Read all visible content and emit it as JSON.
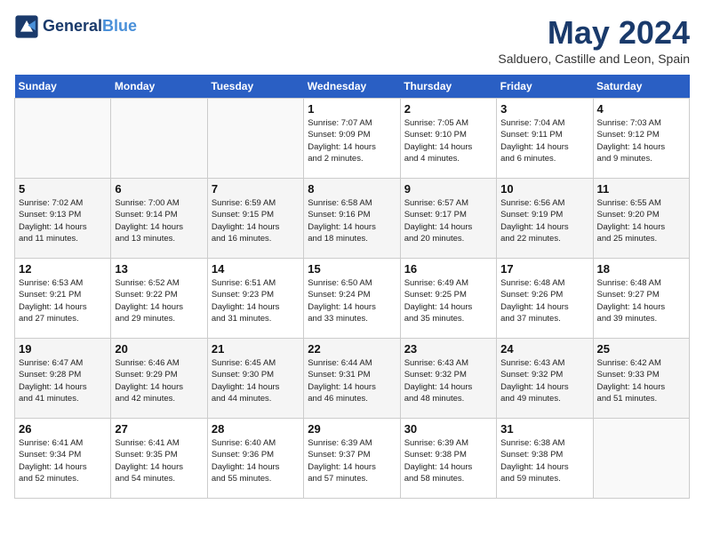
{
  "header": {
    "logo_line1": "General",
    "logo_line2": "Blue",
    "month_title": "May 2024",
    "location": "Salduero, Castille and Leon, Spain"
  },
  "days_of_week": [
    "Sunday",
    "Monday",
    "Tuesday",
    "Wednesday",
    "Thursday",
    "Friday",
    "Saturday"
  ],
  "weeks": [
    [
      {
        "day": "",
        "info": ""
      },
      {
        "day": "",
        "info": ""
      },
      {
        "day": "",
        "info": ""
      },
      {
        "day": "1",
        "info": "Sunrise: 7:07 AM\nSunset: 9:09 PM\nDaylight: 14 hours\nand 2 minutes."
      },
      {
        "day": "2",
        "info": "Sunrise: 7:05 AM\nSunset: 9:10 PM\nDaylight: 14 hours\nand 4 minutes."
      },
      {
        "day": "3",
        "info": "Sunrise: 7:04 AM\nSunset: 9:11 PM\nDaylight: 14 hours\nand 6 minutes."
      },
      {
        "day": "4",
        "info": "Sunrise: 7:03 AM\nSunset: 9:12 PM\nDaylight: 14 hours\nand 9 minutes."
      }
    ],
    [
      {
        "day": "5",
        "info": "Sunrise: 7:02 AM\nSunset: 9:13 PM\nDaylight: 14 hours\nand 11 minutes."
      },
      {
        "day": "6",
        "info": "Sunrise: 7:00 AM\nSunset: 9:14 PM\nDaylight: 14 hours\nand 13 minutes."
      },
      {
        "day": "7",
        "info": "Sunrise: 6:59 AM\nSunset: 9:15 PM\nDaylight: 14 hours\nand 16 minutes."
      },
      {
        "day": "8",
        "info": "Sunrise: 6:58 AM\nSunset: 9:16 PM\nDaylight: 14 hours\nand 18 minutes."
      },
      {
        "day": "9",
        "info": "Sunrise: 6:57 AM\nSunset: 9:17 PM\nDaylight: 14 hours\nand 20 minutes."
      },
      {
        "day": "10",
        "info": "Sunrise: 6:56 AM\nSunset: 9:19 PM\nDaylight: 14 hours\nand 22 minutes."
      },
      {
        "day": "11",
        "info": "Sunrise: 6:55 AM\nSunset: 9:20 PM\nDaylight: 14 hours\nand 25 minutes."
      }
    ],
    [
      {
        "day": "12",
        "info": "Sunrise: 6:53 AM\nSunset: 9:21 PM\nDaylight: 14 hours\nand 27 minutes."
      },
      {
        "day": "13",
        "info": "Sunrise: 6:52 AM\nSunset: 9:22 PM\nDaylight: 14 hours\nand 29 minutes."
      },
      {
        "day": "14",
        "info": "Sunrise: 6:51 AM\nSunset: 9:23 PM\nDaylight: 14 hours\nand 31 minutes."
      },
      {
        "day": "15",
        "info": "Sunrise: 6:50 AM\nSunset: 9:24 PM\nDaylight: 14 hours\nand 33 minutes."
      },
      {
        "day": "16",
        "info": "Sunrise: 6:49 AM\nSunset: 9:25 PM\nDaylight: 14 hours\nand 35 minutes."
      },
      {
        "day": "17",
        "info": "Sunrise: 6:48 AM\nSunset: 9:26 PM\nDaylight: 14 hours\nand 37 minutes."
      },
      {
        "day": "18",
        "info": "Sunrise: 6:48 AM\nSunset: 9:27 PM\nDaylight: 14 hours\nand 39 minutes."
      }
    ],
    [
      {
        "day": "19",
        "info": "Sunrise: 6:47 AM\nSunset: 9:28 PM\nDaylight: 14 hours\nand 41 minutes."
      },
      {
        "day": "20",
        "info": "Sunrise: 6:46 AM\nSunset: 9:29 PM\nDaylight: 14 hours\nand 42 minutes."
      },
      {
        "day": "21",
        "info": "Sunrise: 6:45 AM\nSunset: 9:30 PM\nDaylight: 14 hours\nand 44 minutes."
      },
      {
        "day": "22",
        "info": "Sunrise: 6:44 AM\nSunset: 9:31 PM\nDaylight: 14 hours\nand 46 minutes."
      },
      {
        "day": "23",
        "info": "Sunrise: 6:43 AM\nSunset: 9:32 PM\nDaylight: 14 hours\nand 48 minutes."
      },
      {
        "day": "24",
        "info": "Sunrise: 6:43 AM\nSunset: 9:32 PM\nDaylight: 14 hours\nand 49 minutes."
      },
      {
        "day": "25",
        "info": "Sunrise: 6:42 AM\nSunset: 9:33 PM\nDaylight: 14 hours\nand 51 minutes."
      }
    ],
    [
      {
        "day": "26",
        "info": "Sunrise: 6:41 AM\nSunset: 9:34 PM\nDaylight: 14 hours\nand 52 minutes."
      },
      {
        "day": "27",
        "info": "Sunrise: 6:41 AM\nSunset: 9:35 PM\nDaylight: 14 hours\nand 54 minutes."
      },
      {
        "day": "28",
        "info": "Sunrise: 6:40 AM\nSunset: 9:36 PM\nDaylight: 14 hours\nand 55 minutes."
      },
      {
        "day": "29",
        "info": "Sunrise: 6:39 AM\nSunset: 9:37 PM\nDaylight: 14 hours\nand 57 minutes."
      },
      {
        "day": "30",
        "info": "Sunrise: 6:39 AM\nSunset: 9:38 PM\nDaylight: 14 hours\nand 58 minutes."
      },
      {
        "day": "31",
        "info": "Sunrise: 6:38 AM\nSunset: 9:38 PM\nDaylight: 14 hours\nand 59 minutes."
      },
      {
        "day": "",
        "info": ""
      }
    ]
  ]
}
